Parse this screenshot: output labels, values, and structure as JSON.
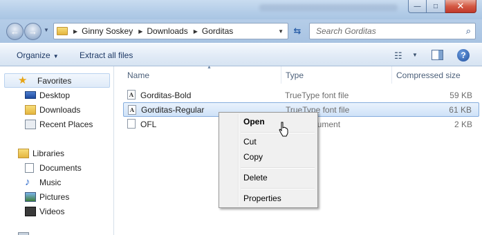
{
  "window": {
    "controls": {
      "minimize": "—",
      "maximize": "□",
      "close": "✕"
    }
  },
  "address": {
    "crumbs": [
      "Ginny Soskey",
      "Downloads",
      "Gorditas"
    ],
    "search_placeholder": "Search Gorditas"
  },
  "toolbar": {
    "organize": "Organize",
    "extract": "Extract all files",
    "help": "?"
  },
  "nav": {
    "favorites_label": "Favorites",
    "favorites": [
      "Desktop",
      "Downloads",
      "Recent Places"
    ],
    "libraries_label": "Libraries",
    "libraries": [
      "Documents",
      "Music",
      "Pictures",
      "Videos"
    ]
  },
  "columns": {
    "name": "Name",
    "type": "Type",
    "size": "Compressed size"
  },
  "files": [
    {
      "name": "Gorditas-Bold",
      "type": "TrueType font file",
      "size": "59 KB",
      "icon": "font-file-icon"
    },
    {
      "name": "Gorditas-Regular",
      "type": "TrueType font file",
      "size": "61 KB",
      "icon": "font-file-icon",
      "selected": true
    },
    {
      "name": "OFL",
      "type": "Text Document",
      "size": "2 KB",
      "icon": "text-file-icon"
    }
  ],
  "context_menu": {
    "open": "Open",
    "cut": "Cut",
    "copy": "Copy",
    "delete": "Delete",
    "properties": "Properties"
  },
  "colors": {
    "selection": "#cfe2f8",
    "titlebar": "#b4cde8",
    "close_button": "#c0392b"
  }
}
